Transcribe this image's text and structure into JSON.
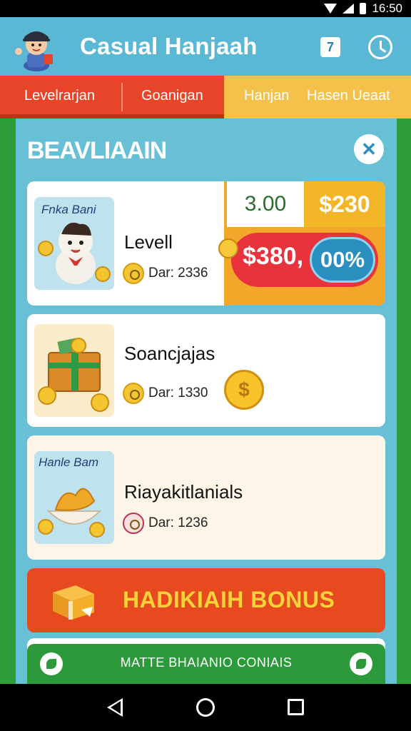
{
  "status_bar": {
    "time": "16:50"
  },
  "header": {
    "title": "Casual Hanjaah",
    "help_label": "7"
  },
  "tabs": [
    {
      "label": "Levelrarjan"
    },
    {
      "label": "Goanigan"
    },
    {
      "label": "Hanjan"
    },
    {
      "label": "Hasen Ueaat"
    }
  ],
  "section": {
    "title": "BEAVLIAAIN",
    "close_label": "✕"
  },
  "cards": [
    {
      "thumb_caption": "Fnka Bani",
      "name": "Levell",
      "meta": "Dar: 2336",
      "price_1": "3.00",
      "price_2": "$230",
      "promo_price": "$380,",
      "promo_discount": "00%"
    },
    {
      "name": "Soancjajas",
      "meta": "Dar: 1330",
      "coin_symbol": "$"
    },
    {
      "thumb_caption": "Hanle Bam",
      "name": "Riayakitlanials",
      "meta": "Dar: 1236"
    }
  ],
  "bonus": {
    "label": "HADIKIAIH BONUS"
  },
  "action": {
    "label": "MATTE BHAIANIO CONIAIS"
  },
  "colors": {
    "header": "#5bb8d4",
    "tab_active": "#e8442a",
    "tab_inactive": "#f4c24a",
    "panel": "#67c0d6",
    "bonus": "#e84a1f",
    "action": "#2c9a3a"
  }
}
